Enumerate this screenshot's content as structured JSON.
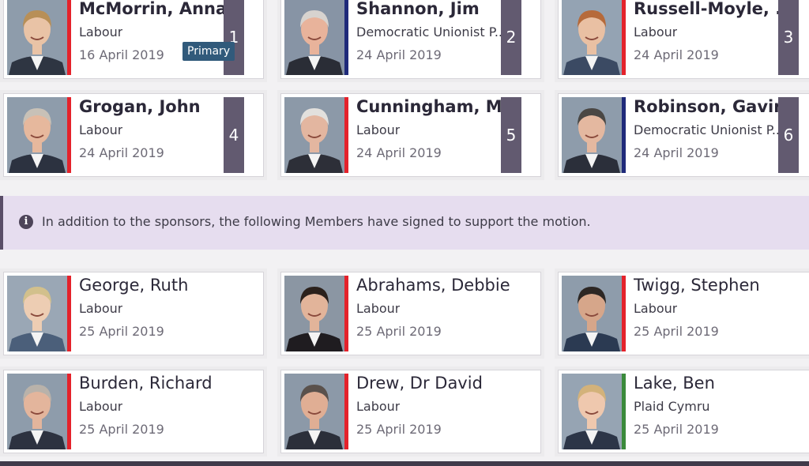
{
  "sponsors": [
    {
      "name": "McMorrin, Anna",
      "party": "Labour",
      "date": "16 April 2019",
      "rank": "1",
      "badge": "Primary",
      "party_color": "#e4222b",
      "skin": "#e9c3a6",
      "hair": "#b88f57",
      "suit": "#2e3542",
      "bg": "#8e9cab"
    },
    {
      "name": "Shannon, Jim",
      "party": "Democratic Unionist P...",
      "date": "24 April 2019",
      "rank": "2",
      "party_color": "#1f2a7a",
      "skin": "#e8b39b",
      "hair": "#d7d3cf",
      "suit": "#2a2d36",
      "bg": "#8794a5"
    },
    {
      "name": "Russell-Moyle, ...",
      "party": "Labour",
      "date": "24 April 2019",
      "rank": "3",
      "party_color": "#e4222b",
      "skin": "#e9c0a3",
      "hair": "#b66a3a",
      "suit": "#3b4a63",
      "bg": "#94a3b3"
    },
    {
      "name": "Grogan, John",
      "party": "Labour",
      "date": "24 April 2019",
      "rank": "4",
      "party_color": "#e4222b",
      "skin": "#e6b89d",
      "hair": "#c8c1b7",
      "suit": "#2c3240",
      "bg": "#8e9cab"
    },
    {
      "name": "Cunningham, M...",
      "party": "Labour",
      "date": "24 April 2019",
      "rank": "5",
      "party_color": "#e4222b",
      "skin": "#e3b6a0",
      "hair": "#e2e0dd",
      "suit": "#2d2f38",
      "bg": "#8c99a8"
    },
    {
      "name": "Robinson, Gavin",
      "party": "Democratic Unionist P...",
      "date": "24 April 2019",
      "rank": "6",
      "party_color": "#1f2a7a",
      "skin": "#e4b8a0",
      "hair": "#4a4744",
      "suit": "#2b2f3a",
      "bg": "#8e9cab"
    }
  ],
  "notice": {
    "icon": "info-icon",
    "icon_glyph": "i",
    "text": "In addition to the sponsors, the following Members have signed to support the motion."
  },
  "supporters": [
    {
      "name": "George, Ruth",
      "party": "Labour",
      "date": "25 April 2019",
      "party_color": "#e4222b",
      "skin": "#edcdb3",
      "hair": "#d2c08c",
      "suit": "#4b5f7a",
      "bg": "#9aa7b5"
    },
    {
      "name": "Abrahams, Debbie",
      "party": "Labour",
      "date": "25 April 2019",
      "party_color": "#e4222b",
      "skin": "#e2b49a",
      "hair": "#2b211c",
      "suit": "#1f1c20",
      "bg": "#8b96a3"
    },
    {
      "name": "Twigg, Stephen",
      "party": "Labour",
      "date": "25 April 2019",
      "party_color": "#e4222b",
      "skin": "#d6a68a",
      "hair": "#2d2724",
      "suit": "#2b3a52",
      "bg": "#8e9cab"
    },
    {
      "name": "Burden, Richard",
      "party": "Labour",
      "date": "25 April 2019",
      "party_color": "#e4222b",
      "skin": "#e3b59c",
      "hair": "#b9b2aa",
      "suit": "#2d3240",
      "bg": "#8e9cab"
    },
    {
      "name": "Drew, Dr David",
      "party": "Labour",
      "date": "25 April 2019",
      "party_color": "#e4222b",
      "skin": "#e0ae94",
      "hair": "#5a514c",
      "suit": "#2b2f3a",
      "bg": "#8c99a8"
    },
    {
      "name": "Lake, Ben",
      "party": "Plaid Cymru",
      "date": "25 April 2019",
      "party_color": "#3b8a3b",
      "skin": "#efc8ae",
      "hair": "#d3b27a",
      "suit": "#2c3547",
      "bg": "#96a4b3"
    }
  ]
}
